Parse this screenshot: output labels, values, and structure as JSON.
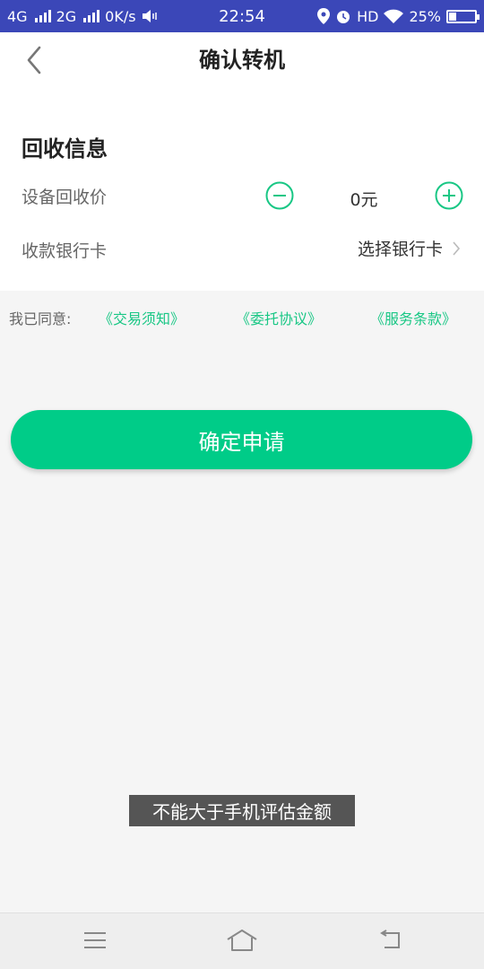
{
  "status_bar": {
    "network_1": "4G",
    "network_2": "2G",
    "speed": "0K/s",
    "time": "22:54",
    "hd": "HD",
    "battery_percent": "25%",
    "battery_level": 0.25
  },
  "header": {
    "title": "确认转机",
    "back_icon": "chevron-left-icon"
  },
  "recycle_info": {
    "section_title": "回收信息",
    "price_label": "设备回收价",
    "price_value": "0元",
    "bank_label": "收款银行卡",
    "bank_select": "选择银行卡"
  },
  "agreement": {
    "label": "我已同意:",
    "links": [
      "《交易须知》",
      "《委托协议》",
      "《服务条款》"
    ]
  },
  "submit_label": "确定申请",
  "toast": "不能大于手机评估金额",
  "colors": {
    "status_bar": "#3b47b8",
    "accent": "#19c785",
    "button": "#00cc88"
  }
}
